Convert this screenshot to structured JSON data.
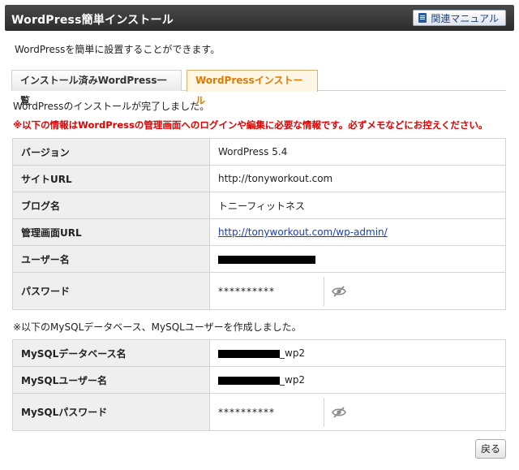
{
  "header": {
    "title": "WordPress簡単インストール",
    "manual_label": "関連マニュアル"
  },
  "intro": "WordPressを簡単に設置することができます。",
  "tabs": [
    {
      "label": "インストール済みWordPress一覧",
      "active": false
    },
    {
      "label": "WordPressインストール",
      "active": true
    }
  ],
  "done_message": "WordPressのインストールが完了しました。",
  "warning": "※以下の情報はWordPressの管理画面へのログインや編集に必要な情報です。必ずメモなどにお控えください。",
  "wp_info": {
    "version_label": "バージョン",
    "version_value": "WordPress 5.4",
    "site_url_label": "サイトURL",
    "site_url_value": "http://tonyworkout.com",
    "blog_name_label": "ブログ名",
    "blog_name_value": "トニーフィットネス",
    "admin_url_label": "管理画面URL",
    "admin_url_value": "http://tonyworkout.com/wp-admin/",
    "username_label": "ユーザー名",
    "password_label": "パスワード",
    "password_value": "**********"
  },
  "sql_note": "※以下のMySQLデータベース、MySQLユーザーを作成しました。",
  "mysql_info": {
    "db_name_label": "MySQLデータベース名",
    "db_name_suffix": "_wp2",
    "user_label": "MySQLユーザー名",
    "user_suffix": "_wp2",
    "password_label": "MySQLパスワード",
    "password_value": "**********"
  },
  "buttons": {
    "back": "戻る"
  },
  "colors": {
    "warning": "#e00000",
    "active_tab": "#e07b00",
    "link": "#1a3fb0",
    "header_bg": "#333333"
  },
  "icons": {
    "manual": "book-icon",
    "password_toggle": "eye-slash-icon"
  }
}
